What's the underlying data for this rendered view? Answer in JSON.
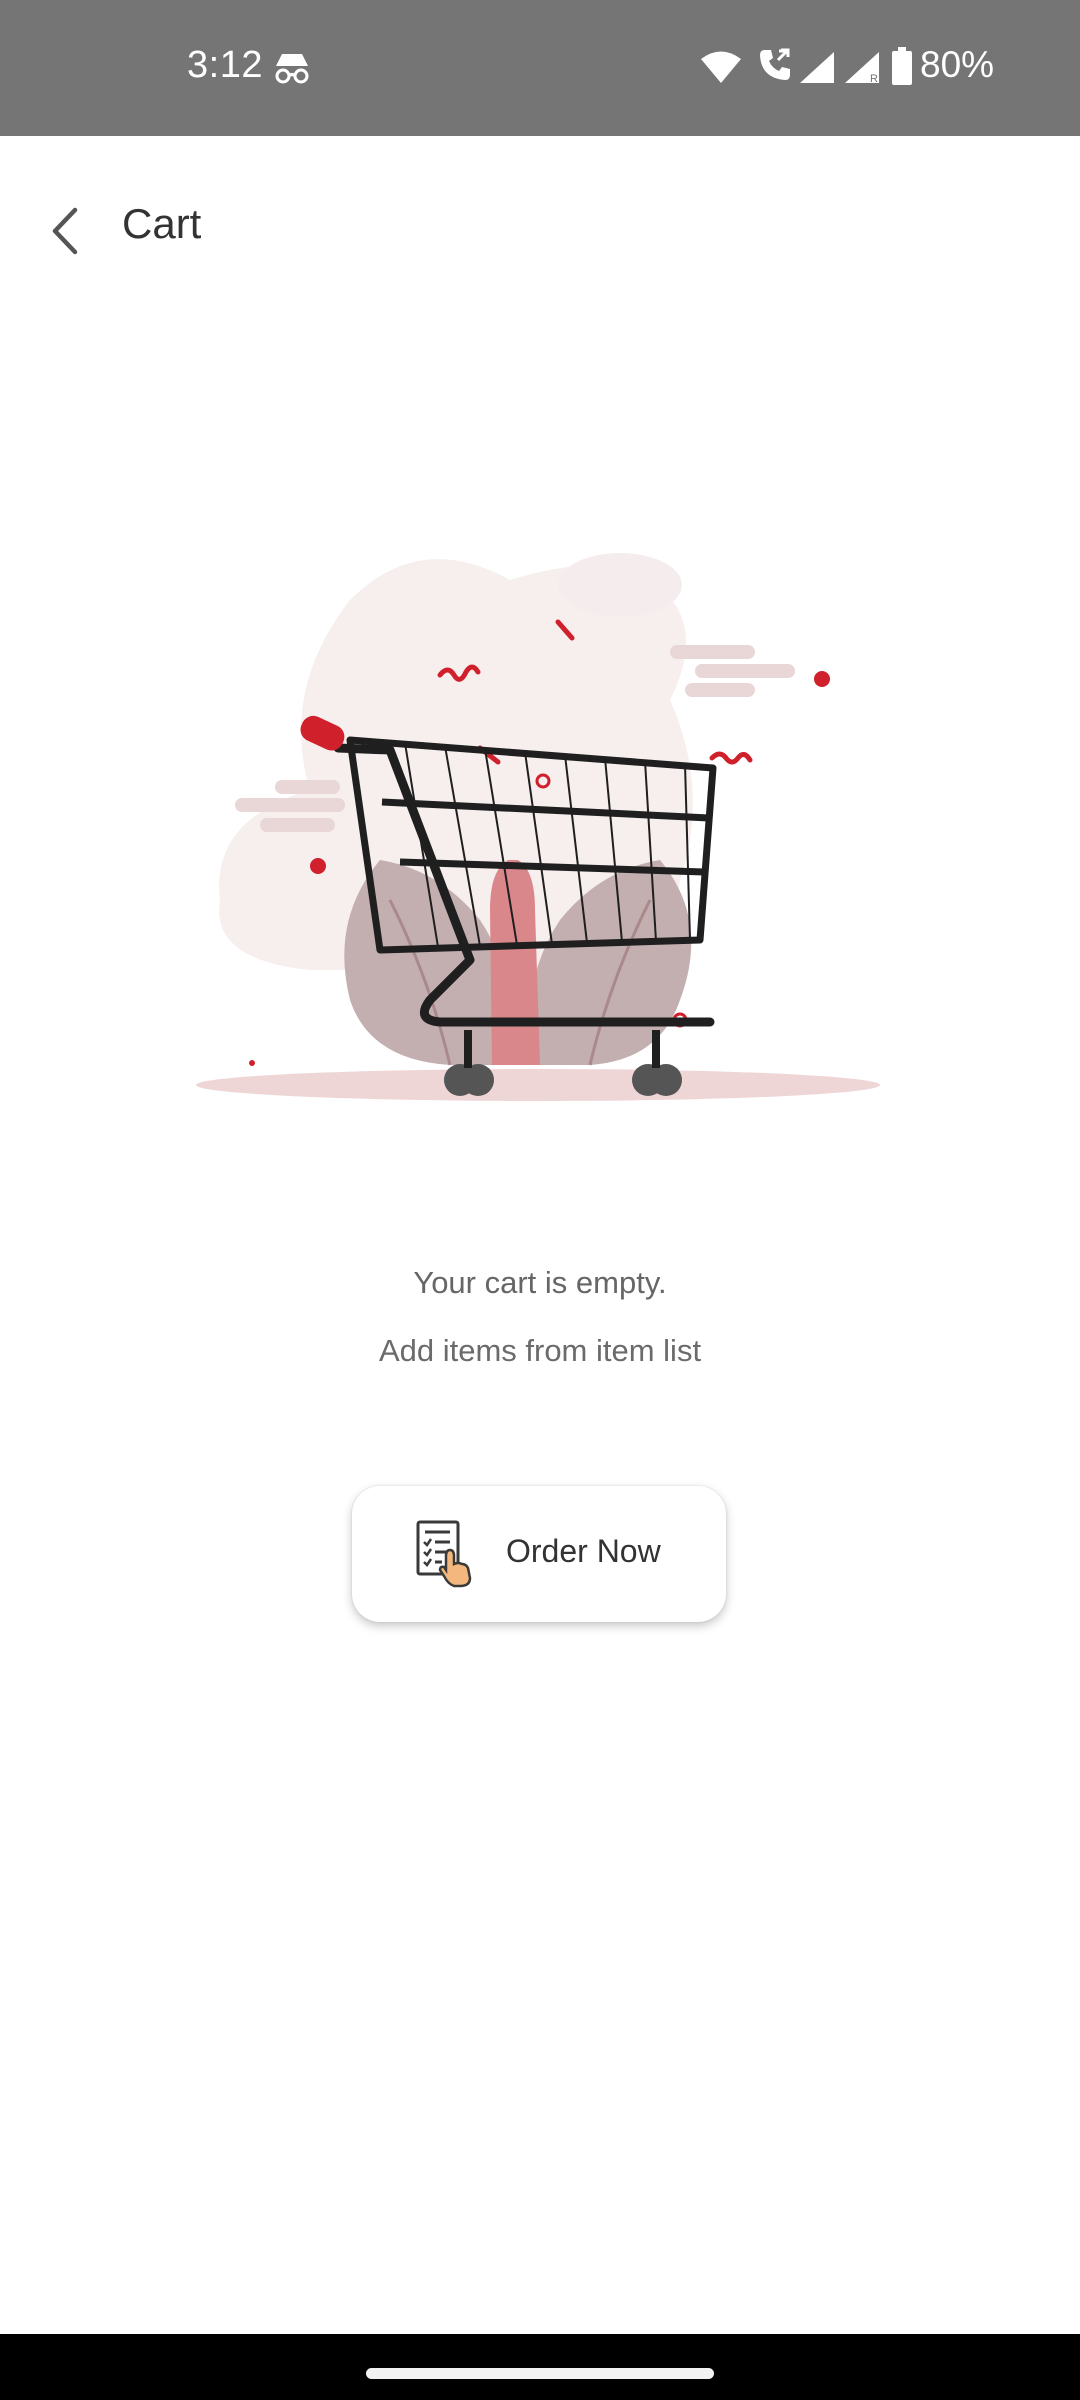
{
  "status_bar": {
    "time": "3:12",
    "battery": "80%",
    "icons": [
      "incognito-icon",
      "wifi-icon",
      "call-icon",
      "signal-icon",
      "signal-roaming-icon",
      "battery-icon"
    ]
  },
  "app_bar": {
    "title": "Cart",
    "back_icon": "chevron-left-icon"
  },
  "empty_state": {
    "illustration": "shopping-cart-illustration",
    "message": "Your cart is empty.",
    "hint": "Add items from item list"
  },
  "order_button": {
    "label": "Order Now",
    "icon": "order-list-icon"
  },
  "colors": {
    "status_bar_bg": "#757575",
    "accent": "#d0202b",
    "text_primary": "#333333",
    "text_secondary": "#666666"
  }
}
